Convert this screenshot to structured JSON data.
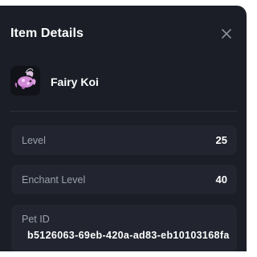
{
  "modal": {
    "title": "Item Details",
    "close_icon": "close-icon"
  },
  "item": {
    "name": "Fairy Koi",
    "image_icon": "fairy-koi-pet-icon"
  },
  "details": {
    "level_label": "Level",
    "level_value": "25",
    "enchant_label": "Enchant Level",
    "enchant_value": "40",
    "pet_id_label": "Pet ID",
    "pet_id_value": "b5126063-69eb-420a-ad83-eb10103168fa"
  },
  "colors": {
    "panel_bg": "#1b1e26",
    "card_bg": "#22252f",
    "label_text": "#9ca0ab",
    "value_text": "#ffffff",
    "pet_accent": "#d38ad6"
  }
}
